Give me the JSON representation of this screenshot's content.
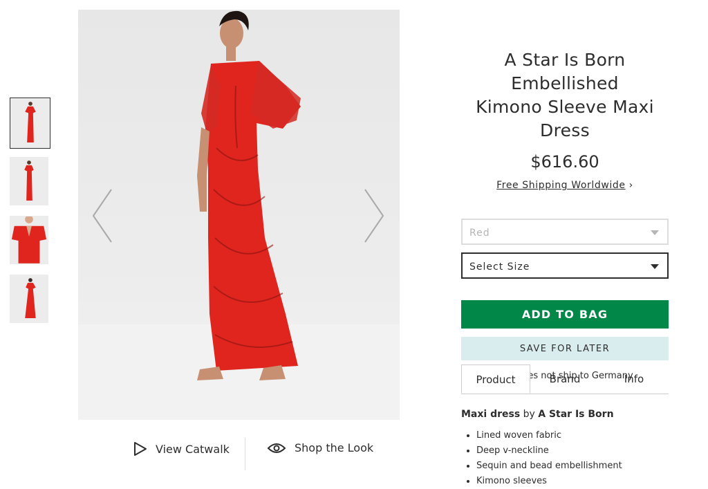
{
  "gallery": {
    "thumbnails": [
      {
        "label": "Front view, full length"
      },
      {
        "label": "Side view, full length"
      },
      {
        "label": "Close-up bodice"
      },
      {
        "label": "Back view"
      }
    ],
    "active_index": 0
  },
  "media_links": {
    "catwalk": "View Catwalk",
    "shop_look": "Shop the Look"
  },
  "product": {
    "title_line1": "A Star Is Born Embellished",
    "title_line2": "Kimono Sleeve Maxi Dress",
    "price": "$616.60",
    "shipping_link": "Free Shipping Worldwide",
    "shipping_chevron": "›",
    "color_select": "Red",
    "size_select": "Select Size",
    "add_to_bag": "ADD TO BAG",
    "save_for_later": "SAVE FOR LATER",
    "ship_note": "This item does not ship to Germany"
  },
  "tabs": [
    {
      "label": "Product"
    },
    {
      "label": "Brand"
    },
    {
      "label": "Info"
    }
  ],
  "description": {
    "type": "Maxi dress",
    "by": "by",
    "brand": "A Star Is Born",
    "bullets": [
      "Lined woven fabric",
      "Deep v-neckline",
      "Sequin and bead embellishment",
      "Kimono sleeves"
    ]
  },
  "colors": {
    "accent_green": "#018849",
    "save_bg": "#d9ecee",
    "dress_red": "#e0251f"
  }
}
